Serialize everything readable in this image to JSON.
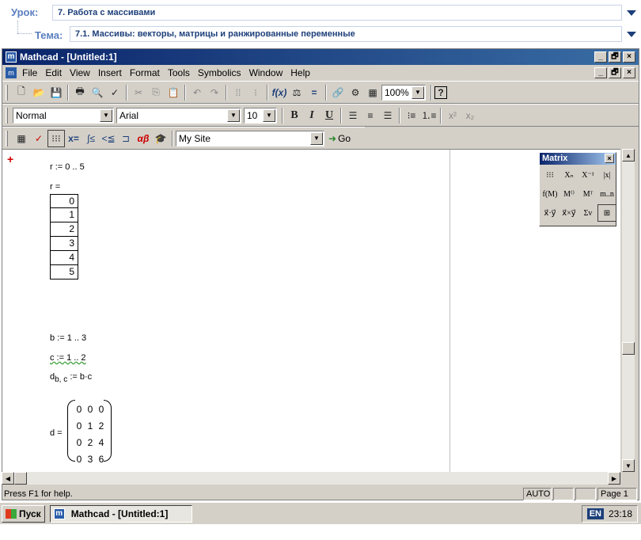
{
  "lesson": {
    "lesson_label": "Урок:",
    "lesson_value": "7. Работа с массивами",
    "topic_label": "Тема:",
    "topic_value": "7.1. Массивы: векторы, матрицы и ранжированные переменные"
  },
  "window": {
    "title": "Mathcad - [Untitled:1]",
    "min": "_",
    "max": "🗗",
    "close": "×"
  },
  "menu": [
    "File",
    "Edit",
    "View",
    "Insert",
    "Format",
    "Tools",
    "Symbolics",
    "Window",
    "Help"
  ],
  "toolbar": {
    "zoom": "100%",
    "style": "Normal",
    "font": "Arial",
    "size": "10",
    "bold": "B",
    "italic": "I",
    "underline": "U",
    "site": "My Site",
    "go": "Go"
  },
  "worksheet": {
    "range_def": "r := 0 .. 5",
    "range_eval": "r =",
    "r_values": [
      "0",
      "1",
      "2",
      "3",
      "4",
      "5"
    ],
    "b_def": "b := 1 .. 3",
    "c_def": "c := 1 .. 2",
    "d_def_left": "d",
    "d_def_sub": "b, c",
    "d_def_right": ":= b·c",
    "d_eval": "d =",
    "d_matrix": [
      "0",
      "0",
      "0",
      "0",
      "1",
      "2",
      "0",
      "2",
      "4",
      "0",
      "3",
      "6"
    ]
  },
  "palette": {
    "title": "Matrix",
    "close": "×",
    "buttons": [
      "⁝⁝⁝",
      "Xₙ",
      "X⁻¹",
      "|x|",
      "f(M)",
      "M⁽⁾",
      "Mᵀ",
      "m..n",
      "x⃗·y⃗",
      "x⃗×y⃗",
      "Σv",
      "⊞"
    ]
  },
  "status": {
    "help": "Press F1 for help.",
    "mode": "AUTO",
    "page": "Page 1"
  },
  "taskbar": {
    "start": "Пуск",
    "task": "Mathcad - [Untitled:1]",
    "lang": "EN",
    "time": "23:18"
  }
}
